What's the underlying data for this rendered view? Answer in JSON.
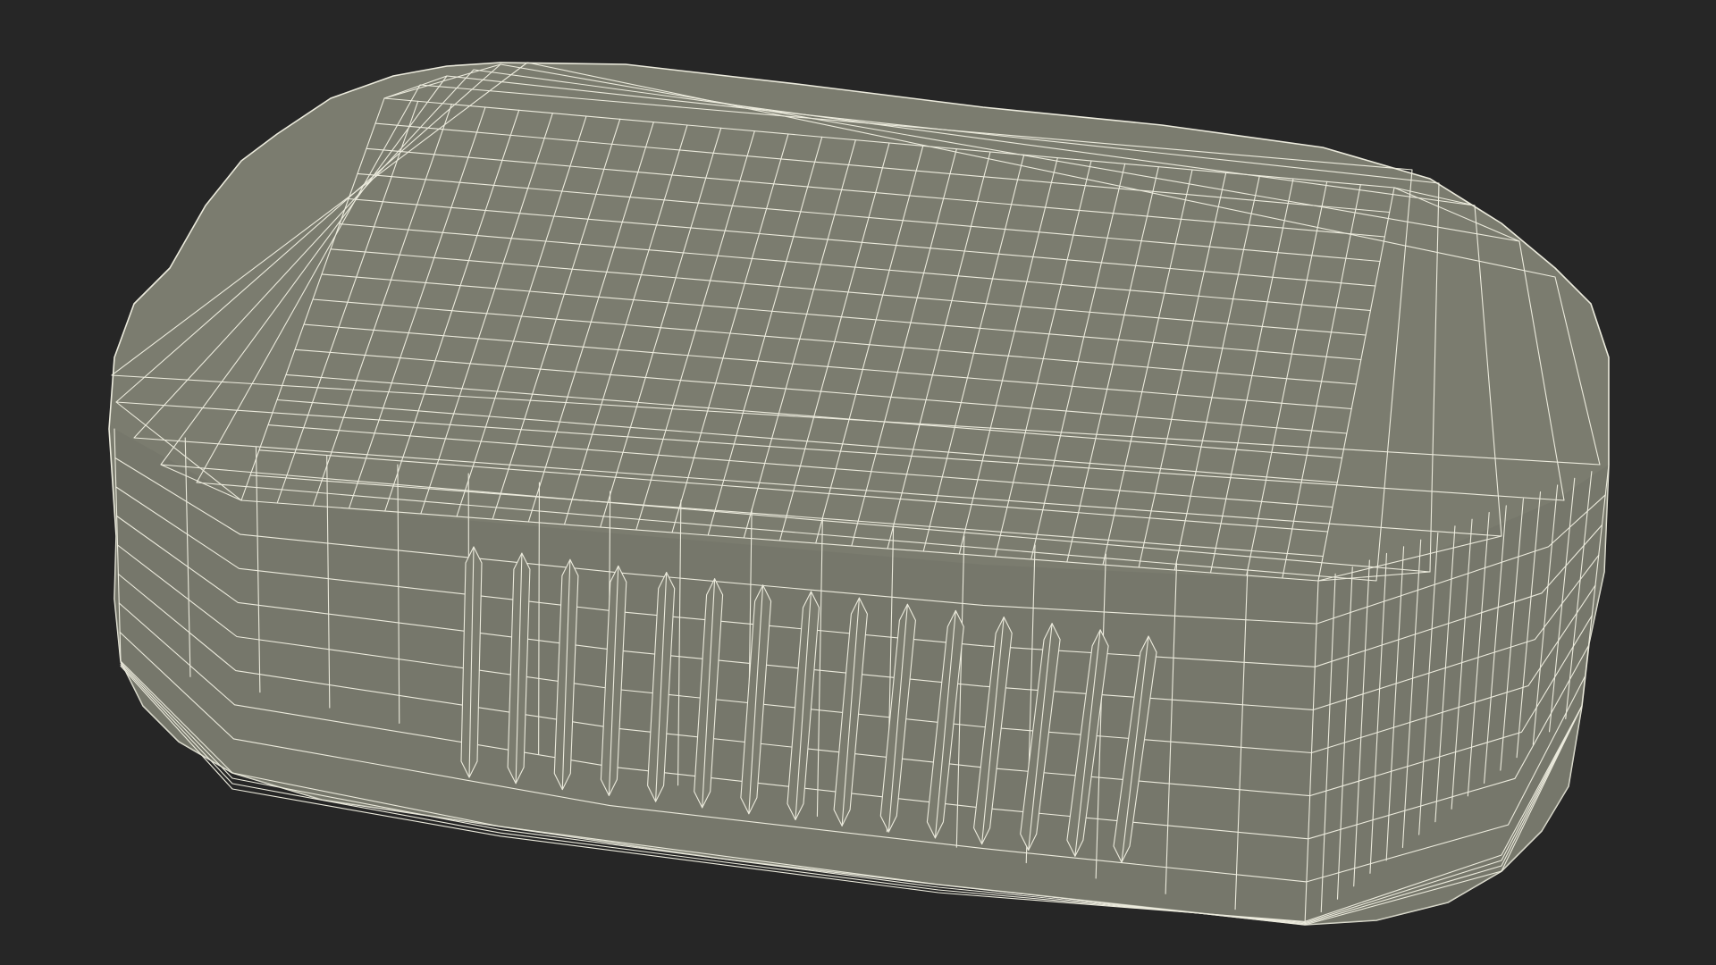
{
  "viewport": {
    "background": "#262626"
  },
  "model": {
    "name": "rounded-rectangular-tray-wireframe",
    "fill_color": "#7b7c6f",
    "wire_color": "#ecebdd",
    "shade_color": "#6e6f63",
    "rib_count": 15
  }
}
